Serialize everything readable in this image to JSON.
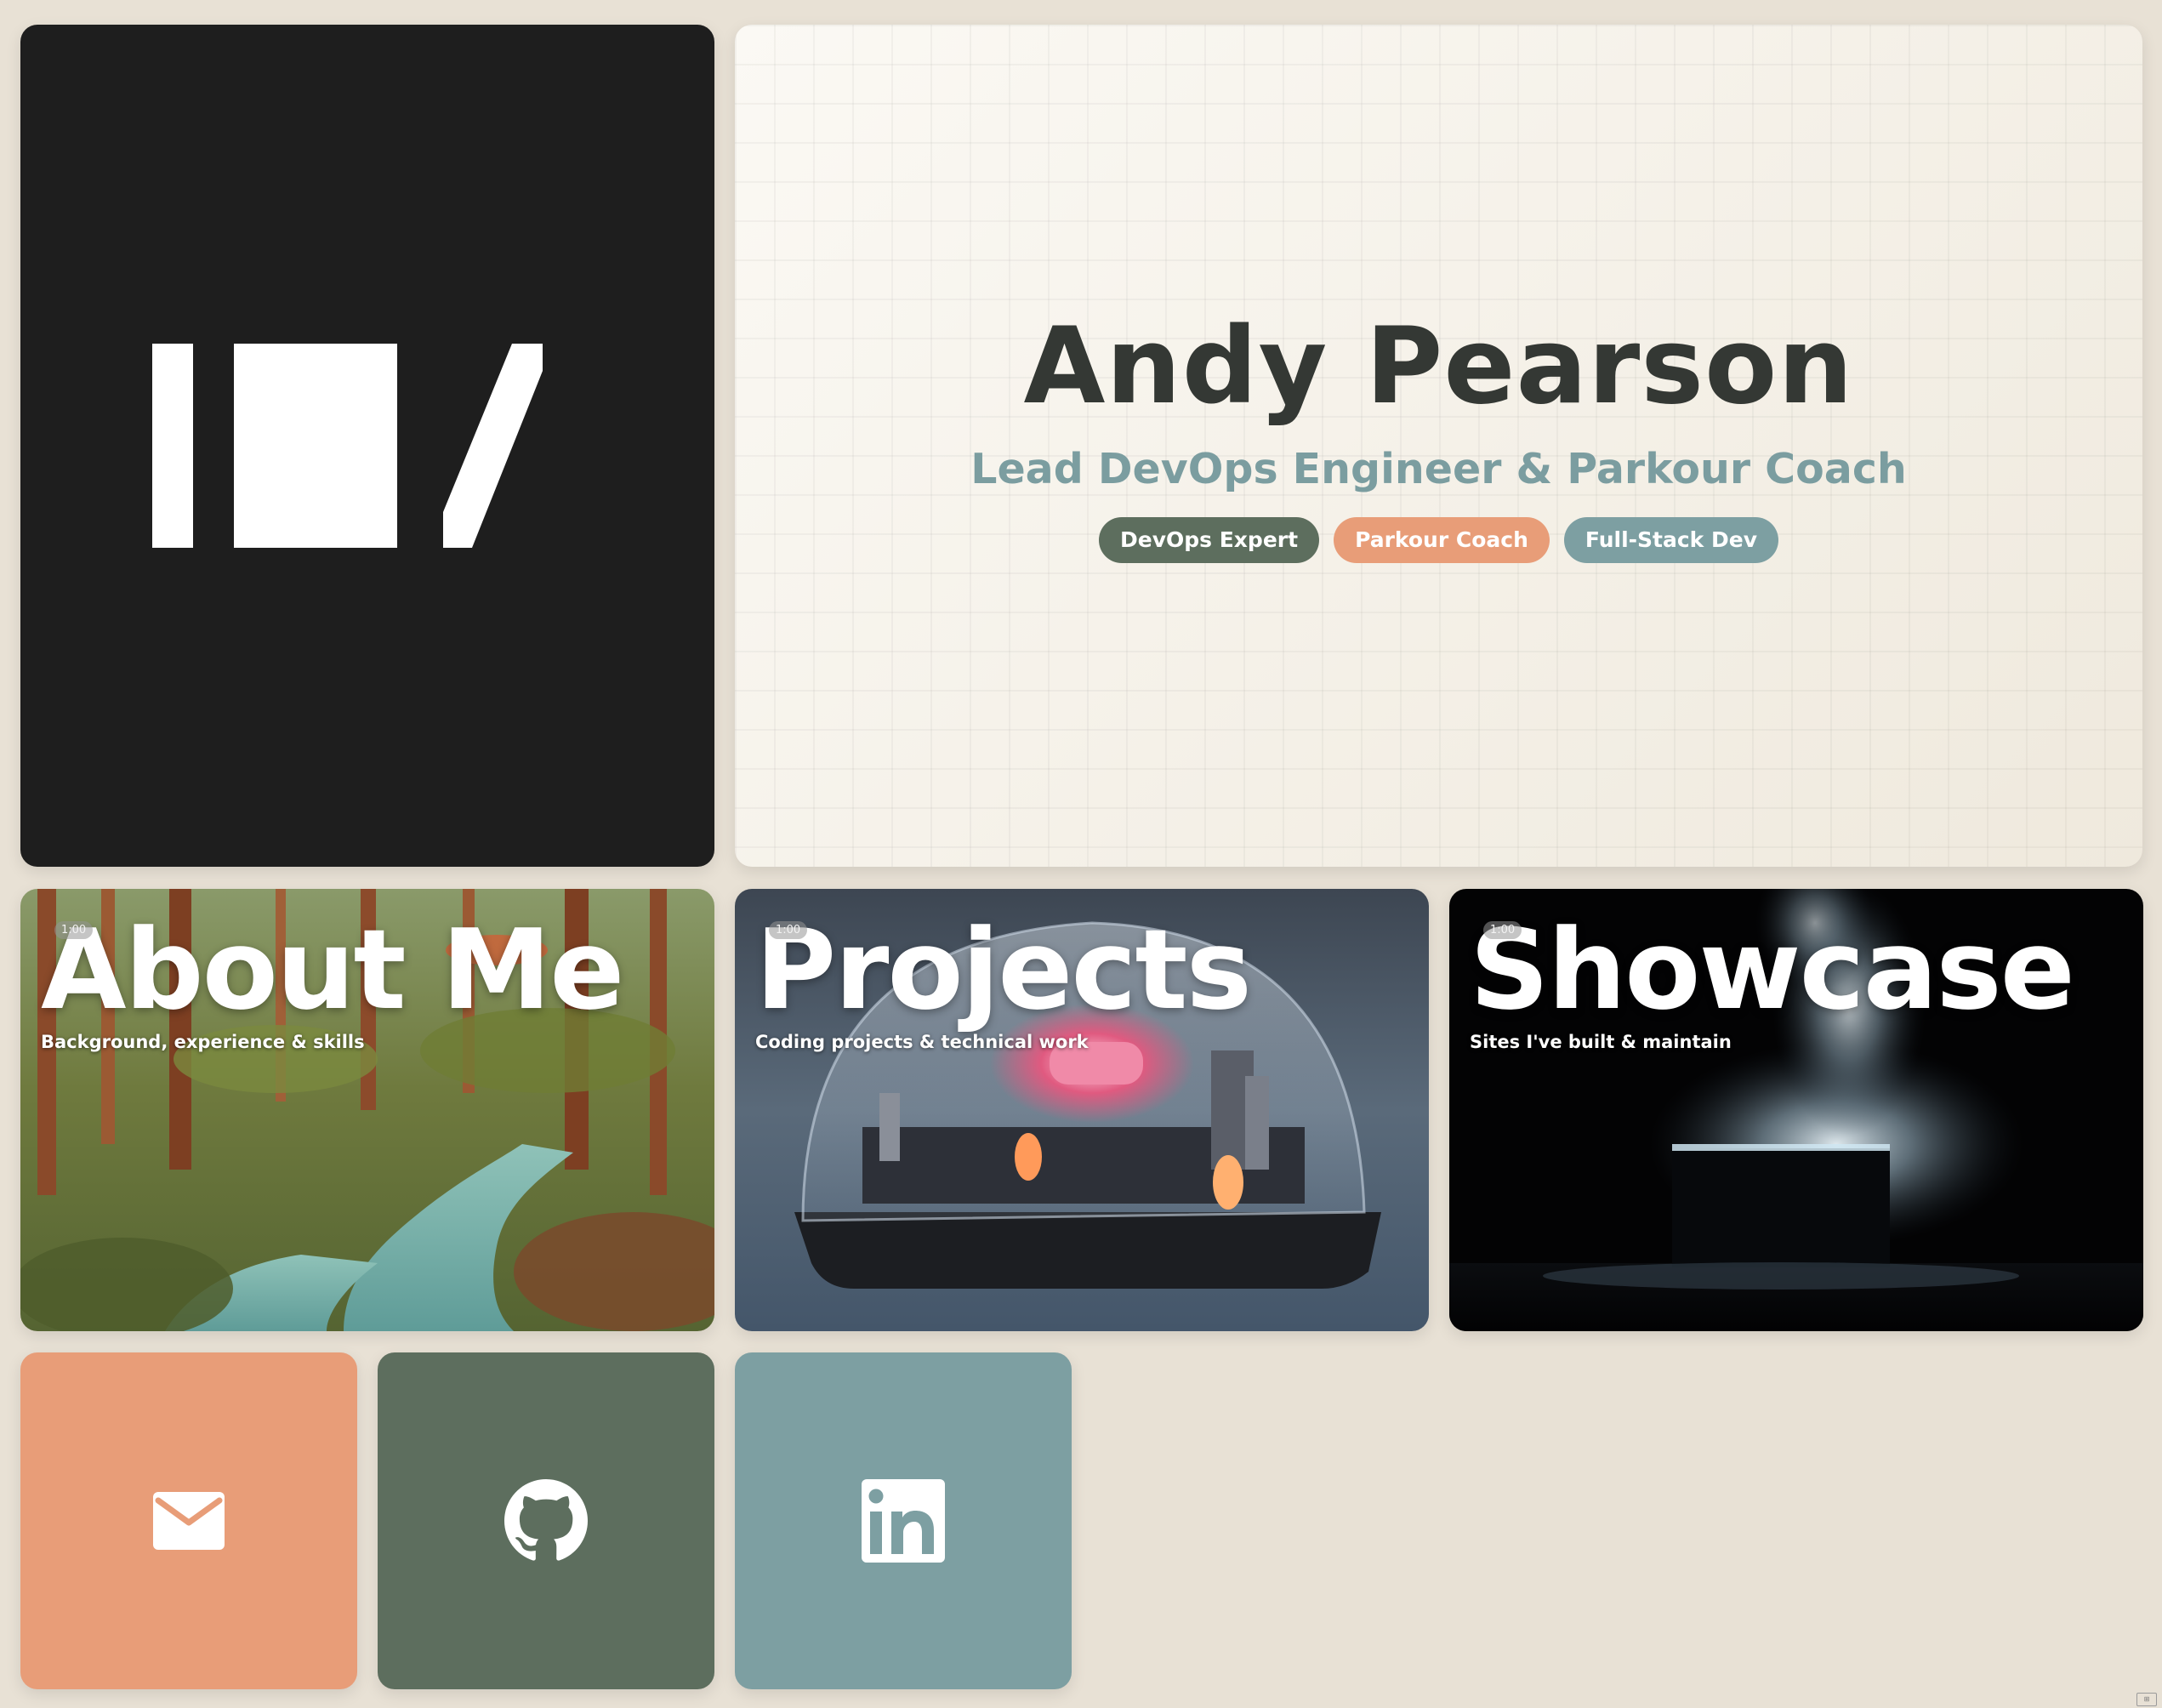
{
  "logo": {
    "name": "site-logo",
    "shape": "bar-square-slash"
  },
  "hero": {
    "name": "Andy Pearson",
    "subtitle": "Lead DevOps Engineer & Parkour Coach",
    "chips": [
      {
        "label": "DevOps Expert",
        "color": "#5d6e5e"
      },
      {
        "label": "Parkour Coach",
        "color": "#e89d78"
      },
      {
        "label": "Full-Stack Dev",
        "color": "#7d9fa2"
      }
    ]
  },
  "sections": [
    {
      "title": "About Me",
      "description": "Background, experience & skills",
      "badge": "1:00"
    },
    {
      "title": "Projects",
      "description": "Coding projects & technical work",
      "badge": "1:00"
    },
    {
      "title": "Showcase",
      "description": "Sites I've built & maintain",
      "badge": "1:00"
    }
  ],
  "social": [
    {
      "label": "Email",
      "icon": "envelope-icon",
      "color": "#e89d78"
    },
    {
      "label": "GitHub",
      "icon": "github-icon",
      "color": "#5d6e5e"
    },
    {
      "label": "LinkedIn",
      "icon": "linkedin-icon",
      "color": "#7d9fa2"
    }
  ],
  "colors": {
    "background": "#e8e1d5",
    "logo_card": "#1e1e1e",
    "name_text": "#343834",
    "subtitle_text": "#7b9da0"
  }
}
